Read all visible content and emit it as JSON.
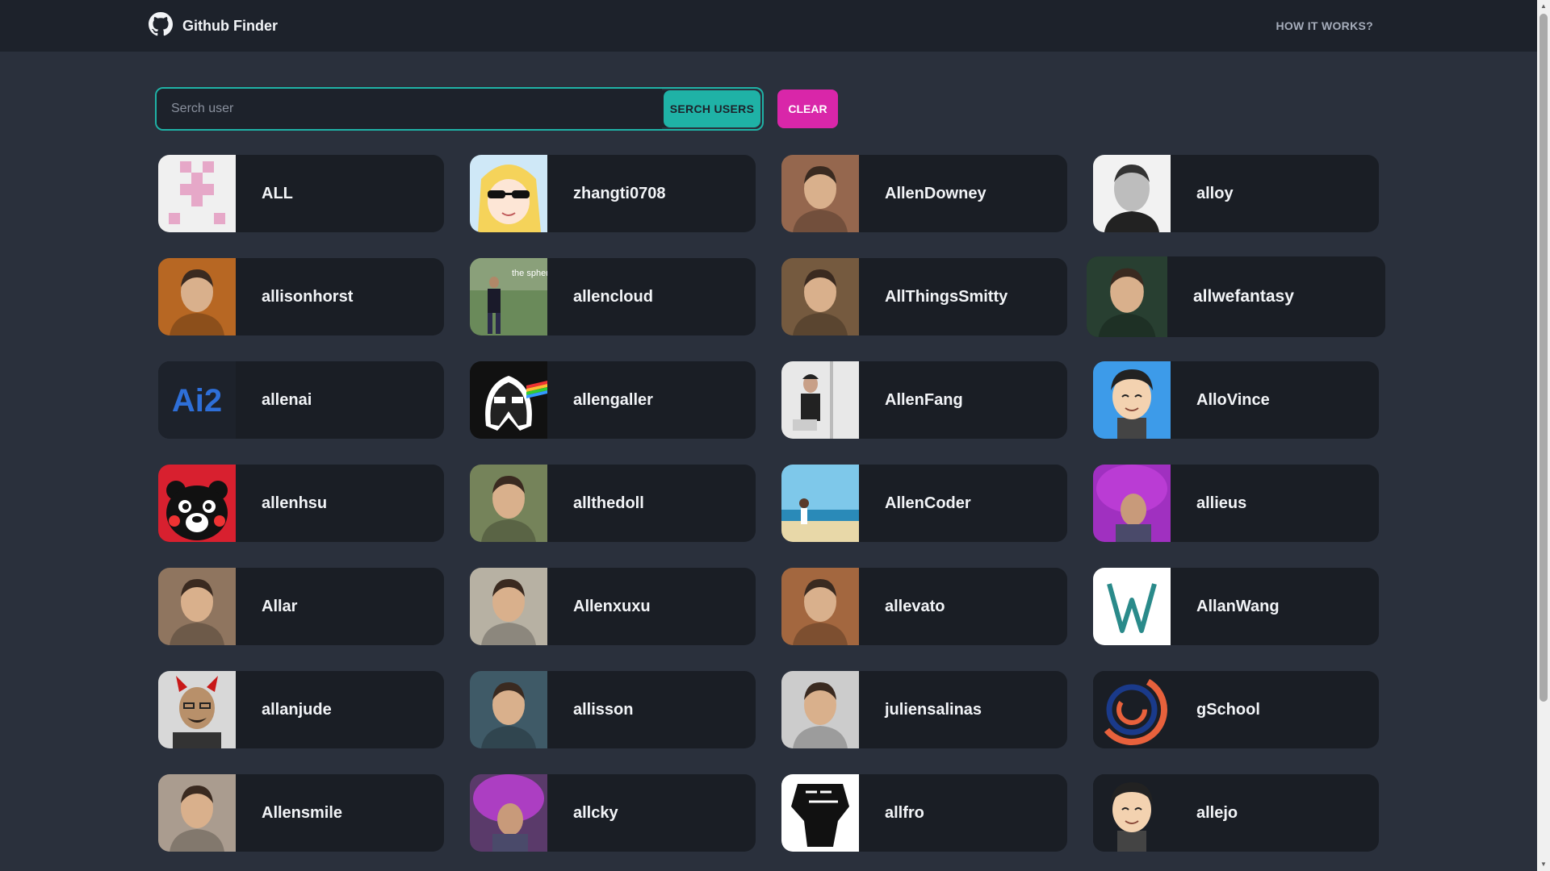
{
  "header": {
    "brand_title": "Github Finder",
    "nav_link": "HOW IT WORKS?"
  },
  "search": {
    "placeholder": "Serch user",
    "value": "",
    "search_button": "SERCH USERS",
    "clear_button": "CLEAR"
  },
  "users": [
    {
      "login": "ALL",
      "avatar": "pink-identicon",
      "color": "#e6a8c8"
    },
    {
      "login": "zhangti0708",
      "avatar": "anime-girl-sunglasses",
      "color": "#f5d35a"
    },
    {
      "login": "AllenDowney",
      "avatar": "photo-portrait",
      "color": "#b07a5c"
    },
    {
      "login": "alloy",
      "avatar": "photo-portrait-bw",
      "color": "#9a9a9a"
    },
    {
      "login": "allisonhorst",
      "avatar": "photo-portrait",
      "color": "#d87a2a"
    },
    {
      "login": "allencloud",
      "avatar": "photo-outdoor",
      "color": "#3c5a3a"
    },
    {
      "login": "AllThingsSmitty",
      "avatar": "photo-portrait",
      "color": "#8a6a4a"
    },
    {
      "login": "allwefantasy",
      "avatar": "photo-portrait",
      "color": "#2f4a3a"
    },
    {
      "login": "allenai",
      "avatar": "ai2-logo",
      "color": "#1d222b"
    },
    {
      "login": "allengaller",
      "avatar": "darth-vader",
      "color": "#111111"
    },
    {
      "login": "AllenFang",
      "avatar": "photo-presenter",
      "color": "#c9c9c9"
    },
    {
      "login": "AlloVince",
      "avatar": "cartoon-man",
      "color": "#3d9be9"
    },
    {
      "login": "allenhsu",
      "avatar": "kumamon-bear",
      "color": "#d8202f"
    },
    {
      "login": "allthedoll",
      "avatar": "photo-portrait",
      "color": "#8a9a6a"
    },
    {
      "login": "AllenCoder",
      "avatar": "photo-beach",
      "color": "#5ab6d8"
    },
    {
      "login": "allieus",
      "avatar": "photo-purple",
      "color": "#a030c0"
    },
    {
      "login": "Allar",
      "avatar": "photo-portrait",
      "color": "#a88a70"
    },
    {
      "login": "Allenxuxu",
      "avatar": "photo-portrait",
      "color": "#d8d0c0"
    },
    {
      "login": "allevato",
      "avatar": "photo-portrait",
      "color": "#c07a4a"
    },
    {
      "login": "AllanWang",
      "avatar": "w-logo",
      "color": "#ffffff"
    },
    {
      "login": "allanjude",
      "avatar": "photo-devil-horns",
      "color": "#7a6050"
    },
    {
      "login": "allisson",
      "avatar": "photo-portrait",
      "color": "#4a6a7a"
    },
    {
      "login": "juliensalinas",
      "avatar": "photo-portrait",
      "color": "#f0f0f0"
    },
    {
      "login": "gSchool",
      "avatar": "gschool-logo",
      "color": "#1a1e25"
    },
    {
      "login": "Allensmile",
      "avatar": "photo-portrait",
      "color": "#c8b8a8"
    },
    {
      "login": "allcky",
      "avatar": "photo-purple",
      "color": "#5a3a6a"
    },
    {
      "login": "allfro",
      "avatar": "raised-fist",
      "color": "#111111"
    },
    {
      "login": "allejo",
      "avatar": "cartoon-man",
      "color": "#1a1e25"
    }
  ],
  "colors": {
    "background": "#2a303c",
    "navbar": "#1d222b",
    "card": "#1a1e25",
    "primary": "#1fb2a6",
    "secondary": "#d926a9",
    "text": "#f2f4f7"
  }
}
